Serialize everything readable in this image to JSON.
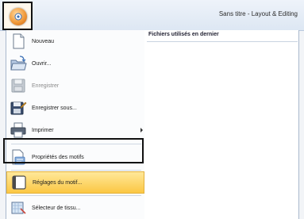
{
  "title_bar": {
    "app_title": "Sans titre - Layout & Editing"
  },
  "recent": {
    "title": "Fichiers utilisés en dernier"
  },
  "menu": {
    "items": [
      {
        "label": "Nouveau",
        "icon": "new-document-icon",
        "disabled": false
      },
      {
        "label": "Ouvrir...",
        "icon": "open-folder-icon",
        "disabled": false
      },
      {
        "label": "Enregistrer",
        "icon": "save-disk-icon",
        "disabled": true
      },
      {
        "label": "Enregistrer sous...",
        "icon": "save-as-icon",
        "disabled": false
      },
      {
        "label": "Imprimer",
        "icon": "printer-icon",
        "disabled": false,
        "submenu": true
      },
      {
        "label": "Propriétés des motifs",
        "icon": "properties-icon",
        "disabled": false
      },
      {
        "label": "Réglages du motif...",
        "icon": "design-settings-icon",
        "disabled": false,
        "highlighted": true
      },
      {
        "label": "Sélecteur de tissu...",
        "icon": "fabric-selector-icon",
        "disabled": false
      }
    ]
  },
  "colors": {
    "highlight": "#fbc743",
    "frame": "#111111"
  }
}
